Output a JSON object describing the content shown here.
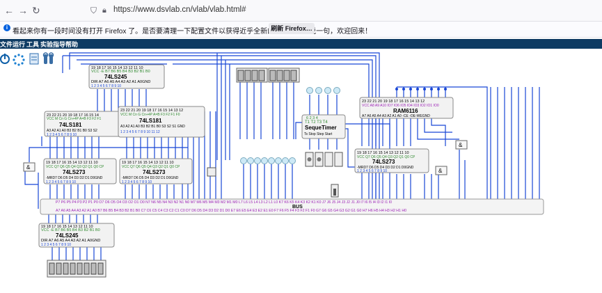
{
  "browser": {
    "url_host": "https://www.dsvlab.cn",
    "url_path": "/vlab/vlab.html#",
    "notice": "看起来你有一段时间没有打开 Firefox 了。是否要清理一下配置文件以获得近乎全新的体验？顺便说一句，欢迎回来！",
    "notice_button": "刷新 Firefox…"
  },
  "menu": {
    "items": [
      "文件",
      "运行",
      "工具",
      "实验指导",
      "帮助"
    ]
  },
  "chips": {
    "ls245_top": {
      "pins_top_nums": "19 18  17  16  15  14  13  12  11  10",
      "pins_top_names": "VCC -E  B7  B6  B5  B4  B3  B2  B1  B0",
      "name": "74LS245",
      "pins_bot_names": "DIR A7  A6  A5  A4  A3  A2  A1  A0GND",
      "pins_bot_nums": "1    2    3    4    5    6    7    8    9  10"
    },
    "ls181_left": {
      "pins_top_nums": "23  22  21  20  19  18  17  16  15  14",
      "pins_top_names": "VCC  M   Cn   G  Cn+4P  A=B F3   F2  F1",
      "name": "74LS181",
      "pins_bot_names": "A3  A2  A1  A0  B3  B2  B1  B0  S3  S2",
      "pins_bot_nums": "1    2    3    4    5    6    7    8    9  10"
    },
    "ls181_right": {
      "pins_top_nums": "23  22  21  20  19  18  17  16  15  14  13  12",
      "pins_top_names": "VCC  M   Cn   G  Cn+4P  A=B F3   F2  F1  F0",
      "name": "74LS181",
      "pins_bot_names": "A3  A2  A1  A0  B3  B2  B1  B0  S3  S2  S1 GND",
      "pins_bot_nums": "1    2    3    4    5    6    7    8    9  10  11  12"
    },
    "ls273_left": {
      "pins_top_nums": "19  18  17  16  15  14  13  12  11  10",
      "pins_top_names": "VCC Q7  Q6  Q5  Q4  Q3  Q2  Q1  Q0  CP",
      "name": "74LS273",
      "pins_bot_names": "-MRD7  D6  D5  D4  D3  D2  D1  D0GND",
      "pins_bot_nums": "1    2    3    4    5    6    7    8    9  10"
    },
    "ls273_right": {
      "pins_top_nums": "19  18  17  16  15  14  13  12  11  10",
      "pins_top_names": "VCC Q7  Q6  Q5  Q4  Q3  Q2  Q1  Q0  CP",
      "name": "74LS273",
      "pins_bot_names": "-MRD7  D6  D5  D4  D3  D2  D1  D0GND",
      "pins_bot_nums": "1    2    3    4    5    6    7    8    9  10"
    },
    "ls273_far": {
      "pins_top_nums": "19  18  17  16  15  14  13  12  11  10",
      "pins_top_names": "VCC Q7  Q6  Q5  Q4  Q3  Q2  Q1  Q0  CP",
      "name": "74LS273",
      "pins_bot_names": "-MRD7  D6  D5  D4  D3  D2  D1  D0GND",
      "pins_bot_nums": "1    2    3    4    5    6    7    8    9  10"
    },
    "ram6116": {
      "pins_top_nums": "23  22  21  20   19  18  17  16  15  14  13  12",
      "pins_top_names": "VCC A8  A9  A10 IO7 IO6 IO5 IO4 IO3 IO2 IO1 IO0",
      "name": "RAM6116",
      "pins_bot_names": "A7  A6  A5  A4  A3  A2  A1  A0  -CE -OE-WEGND",
      "pins_bot_nums": "1    2    3    4    5    6    7    8    9  10  11"
    },
    "seq_timer": {
      "pins_top_nums": "6    2    3    4",
      "pins_top_names": "T1   T2   T3   T4",
      "name": "SequeTimer",
      "pins_bot_names": "Ts  Stop Step Start"
    },
    "ls245_bottom": {
      "pins_top_nums": "19 18  17  16  15  14  13  12  11  10",
      "pins_top_names": "VCC -E  B7  B6  B5  B4  B3  B2  B1  B0",
      "name": "74LS245",
      "pins_bot_names": "DIR A7  A6  A5  A4  A3  A2  A1  A0GND",
      "pins_bot_nums": "1    2    3    4    5    6    7    8    9  10"
    }
  },
  "bus": {
    "label": "BUS",
    "top_labels": "P7  P6  P5  P4  P3  P2  P1  P0          O7  O6  O5  O4  O3  O2  O1  O0    N7  N6  N5  N4  N3  N2  N1  N0     M7  M6  M5  M4  M3  M2  M1  M0    L7  L6  L5  L4  L3  L2  L1  L0     K7  K6  K5  K4  K3  K2  K1  K0     J7  J6  J5  J4  J3  J2  J1  J0      I7  I6  I5  I4  I3  I2  I1  I0",
    "bottom_labels": "A7  A6  A5  A4  A3  A2  A1  A0        B7  B6  B5  B4  B3  B2  B1  B0    C7  C6  C5  C4  C3  C2  C1  C0     D7  D6  D5  D4  D3  D2  D1  D0    E7  E6  E5  E4  E3  E2  E1  E0     F7  F6  F5  F4  F3  F2  F1  F0     G7  G6  G5  G4  G3  G2  G1  G0      H7  H6  H5  H4  H3  H2  H1  H0"
  },
  "gates": {
    "and_label": "&"
  },
  "colors": {
    "wire": "#1846d6",
    "pin_purple": "#9b1fb5",
    "pin_green": "#2f8a2f",
    "menubar": "#0e3b63"
  }
}
